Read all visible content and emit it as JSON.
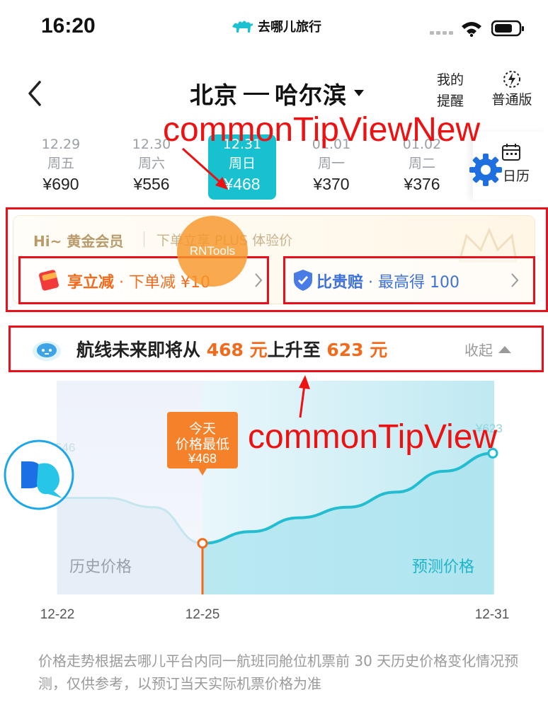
{
  "status": {
    "time": "16:20",
    "brand": "去哪儿旅行"
  },
  "nav": {
    "title_from": "北京",
    "title_to": "哈尔滨",
    "mine_line1": "我的",
    "mine_line2": "提醒",
    "mode_label": "普通版"
  },
  "dates": [
    {
      "date": "12.29",
      "weekday": "周五",
      "price": "¥690",
      "active": false
    },
    {
      "date": "12.30",
      "weekday": "周六",
      "price": "¥556",
      "active": false
    },
    {
      "date": "12.31",
      "weekday": "周日",
      "price": "¥468",
      "active": true
    },
    {
      "date": "01.01",
      "weekday": "周一",
      "price": "¥370",
      "active": false
    },
    {
      "date": "01.02",
      "weekday": "周二",
      "price": "¥376",
      "active": false
    }
  ],
  "calendar_label": "日历",
  "member": {
    "greeting": "Hi~ 黄金会员",
    "promo": "下单立享 PLUS 体验价",
    "benefit_left_title": "享立减",
    "benefit_left_sub": " · 下单减 ¥10",
    "benefit_right_title": "比贵赔",
    "benefit_right_sub": " · 最高得 100"
  },
  "rntools_label": "RNTools",
  "annotations": {
    "new_view": "commonTipViewNew",
    "tip_view": "commonTipView"
  },
  "tip": {
    "prefix": "航线未来即将从 ",
    "from_price": "468 元",
    "middle": "上升至 ",
    "to_price": "623 元",
    "collapse": "收起"
  },
  "chart_data": {
    "type": "line",
    "title": "",
    "x_labels": [
      "12-22",
      "12-25",
      "12-31"
    ],
    "series": [
      {
        "name": "历史价格",
        "x": [
          "12-22",
          "12-23",
          "12-24",
          "12-25"
        ],
        "values": [
          546,
          546,
          530,
          468
        ],
        "color": "#bfe6ef"
      },
      {
        "name": "预测价格",
        "x": [
          "12-25",
          "12-26",
          "12-27",
          "12-28",
          "12-29",
          "12-30",
          "12-31"
        ],
        "values": [
          468,
          488,
          512,
          530,
          556,
          592,
          623
        ],
        "color": "#2bbfd2"
      }
    ],
    "start_label": "546",
    "end_label": "¥623",
    "today_callout": [
      "今天",
      "价格最低",
      "¥468"
    ],
    "history_label": "历史价格",
    "forecast_label": "预测价格",
    "grid": false,
    "legend": "none"
  },
  "note": "价格走势根据去哪儿平台内同一航班同舱位机票前 30 天历史价格变化情况预测，仅供参考，以预订当天实际机票价格为准",
  "colors": {
    "accent": "#17c1d0",
    "orange": "#f26b1d",
    "blue": "#3e72d8",
    "annotation": "#ee1111"
  }
}
